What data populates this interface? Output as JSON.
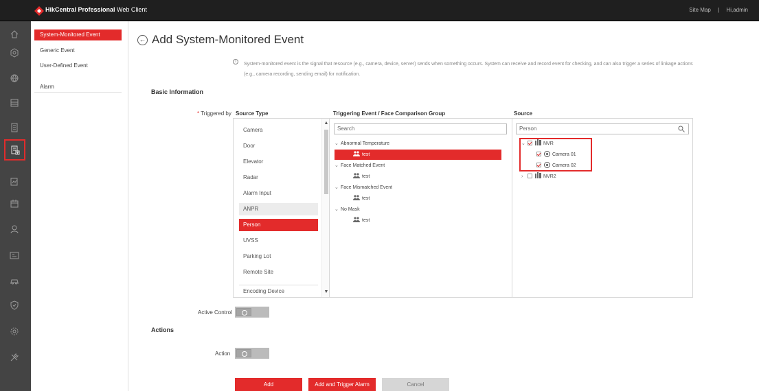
{
  "header": {
    "brand_bold": "HikCentral Professional",
    "brand_rest": "Web Client",
    "site_map": "Site Map",
    "separator": "|",
    "user": "Hi,admin",
    "accent": "#e32b2b"
  },
  "iconbar": {
    "icons": [
      "home-icon",
      "target-icon",
      "globe-icon",
      "layers-icon",
      "document-icon",
      "event-config-icon",
      "report-icon",
      "calendar-icon",
      "person-icon",
      "card-icon",
      "vehicle-icon",
      "shield-icon",
      "gear-icon",
      "tools-icon"
    ],
    "active_index": 5
  },
  "nav": {
    "items": [
      {
        "label": "System-Monitored Event",
        "active": true
      },
      {
        "label": "Generic Event",
        "active": false
      },
      {
        "label": "User-Defined Event",
        "active": false
      },
      {
        "label": "Alarm",
        "active": false
      }
    ]
  },
  "page": {
    "title": "Add System-Monitored Event",
    "info_line1": "System-monitored event is the signal that resource (e.g., camera, device, server) sends when something occurs. System can receive and record event for checking, and can also trigger a series of linkage actions",
    "info_line2": "(e.g., camera recording, sending email) for notification."
  },
  "basic": {
    "section": "Basic Information",
    "triggered_by_required": "*",
    "triggered_by": "Triggered by",
    "col_source_type": "Source Type",
    "col_event": "Triggering Event / Face Comparison Group",
    "col_source": "Source"
  },
  "source_types": [
    {
      "label": "Camera",
      "state": "normal"
    },
    {
      "label": "Door",
      "state": "normal"
    },
    {
      "label": "Elevator",
      "state": "normal"
    },
    {
      "label": "Radar",
      "state": "normal"
    },
    {
      "label": "Alarm Input",
      "state": "normal"
    },
    {
      "label": "ANPR",
      "state": "hover"
    },
    {
      "label": "Person",
      "state": "selected"
    },
    {
      "label": "UVSS",
      "state": "normal"
    },
    {
      "label": "Parking Lot",
      "state": "normal"
    },
    {
      "label": "Remote Site",
      "state": "normal"
    },
    {
      "label": "Encoding Device",
      "state": "normal"
    }
  ],
  "events": {
    "search_placeholder": "Search",
    "groups": [
      {
        "label": "Abnormal Temperature",
        "child": "test",
        "child_selected": true
      },
      {
        "label": "Face Matched Event",
        "child": "test",
        "child_selected": false
      },
      {
        "label": "Face Mismatched Event",
        "child": "test",
        "child_selected": false
      },
      {
        "label": "No Mask",
        "child": "test",
        "child_selected": false
      }
    ]
  },
  "sources": {
    "search_value": "Person",
    "nvr": "NVR",
    "camera1": "Camera 01",
    "camera2": "Camera 02",
    "nvr2": "NVR2"
  },
  "active_control": {
    "label": "Active Control",
    "on": false
  },
  "actions": {
    "section": "Actions",
    "action_label": "Action",
    "action_on": false
  },
  "buttons": {
    "add": "Add",
    "add_trigger": "Add and Trigger Alarm",
    "cancel": "Cancel"
  }
}
